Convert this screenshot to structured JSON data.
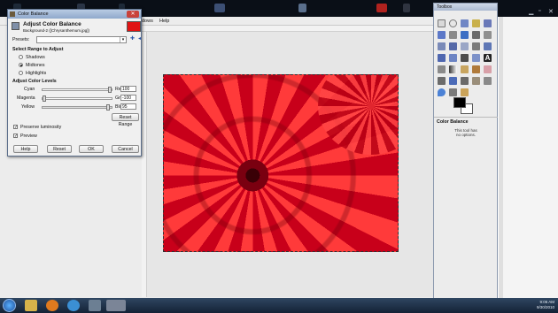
{
  "main_window": {
    "menu_visible_item1": "dows",
    "menu_visible_item2": "Help"
  },
  "dialog": {
    "title": "Color Balance",
    "header_title": "Adjust Color Balance",
    "header_subtitle": "Background-2 ([Chrysanthemum.jpg])",
    "close_glyph": "✕",
    "presets_label": "Presets:",
    "presets_value": "",
    "add_glyph": "✚",
    "menu_glyph": "◂",
    "select_range_heading": "Select Range to Adjust",
    "ranges": [
      "Shadows",
      "Midtones",
      "Highlights"
    ],
    "selected_range": "Midtones",
    "levels_heading": "Adjust Color Levels",
    "sliders": [
      {
        "left": "Cyan",
        "right": "Red",
        "value": "100",
        "position": 1.0
      },
      {
        "left": "Magenta",
        "right": "Green",
        "value": "-100",
        "position": 0.0
      },
      {
        "left": "Yellow",
        "right": "Blue",
        "value": "95",
        "position": 0.975
      }
    ],
    "reset_range_label": "Reset Range",
    "preserve_luminosity_label": "Preserve luminosity",
    "preserve_luminosity_checked": true,
    "preview_label": "Preview",
    "preview_checked": true,
    "buttons": {
      "help": "Help",
      "reset": "Reset",
      "ok": "OK",
      "cancel": "Cancel"
    }
  },
  "toolbox": {
    "title": "Toolbox",
    "tool_options_title": "Color Balance",
    "tool_options_note": "This tool has no options.",
    "fg_color": "#000000",
    "bg_color": "#ffffff"
  },
  "taskbar": {
    "time": "9:06 AM",
    "date": "9/30/2010"
  }
}
